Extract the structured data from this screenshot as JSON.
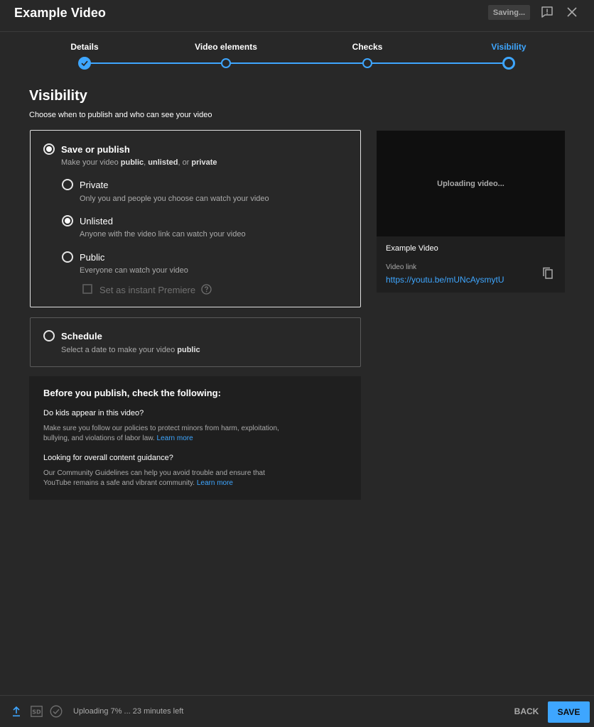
{
  "header": {
    "title": "Example Video",
    "saving_badge": "Saving...",
    "feedback_icon": "feedback-icon",
    "close_icon": "close-icon"
  },
  "stepper": {
    "steps": [
      {
        "label": "Details",
        "state": "done"
      },
      {
        "label": "Video elements",
        "state": "pending"
      },
      {
        "label": "Checks",
        "state": "pending"
      },
      {
        "label": "Visibility",
        "state": "current"
      }
    ],
    "accent_color": "#3ea6ff"
  },
  "page": {
    "title": "Visibility",
    "subtitle": "Choose when to publish and who can see your video"
  },
  "save_or_publish": {
    "title": "Save or publish",
    "selected": true,
    "desc_prefix": "Make your video ",
    "desc_public": "public",
    "desc_sep1": ", ",
    "desc_unlisted": "unlisted",
    "desc_sep2": ", or ",
    "desc_private": "private",
    "options": [
      {
        "label": "Private",
        "desc": "Only you and people you choose can watch your video",
        "checked": false
      },
      {
        "label": "Unlisted",
        "desc": "Anyone with the video link can watch your video",
        "checked": true
      },
      {
        "label": "Public",
        "desc": "Everyone can watch your video",
        "checked": false
      }
    ],
    "premiere_label": "Set as instant Premiere",
    "premiere_checked": false
  },
  "schedule": {
    "title": "Schedule",
    "desc_prefix": "Select a date to make your video ",
    "desc_bold": "public",
    "selected": false
  },
  "info": {
    "heading": "Before you publish, check the following:",
    "q1": "Do kids appear in this video?",
    "t1_line1": "Make sure you follow our policies to protect minors from harm, exploitation,",
    "t1_line2": "bullying, and violations of labor law. ",
    "t1_link": "Learn more",
    "q2": "Looking for overall content guidance?",
    "t2_line1": "Our Community Guidelines can help you avoid trouble and ensure that",
    "t2_line2": "YouTube remains a safe and vibrant community. ",
    "t2_link": "Learn more"
  },
  "preview": {
    "uploading_text": "Uploading video...",
    "title": "Example Video",
    "link_label": "Video link",
    "link": "https://youtu.be/mUNcAysmytU"
  },
  "footer": {
    "status": "Uploading 7% ... 23 minutes left",
    "back_label": "BACK",
    "save_label": "SAVE",
    "upload_progress_percent": 7
  }
}
